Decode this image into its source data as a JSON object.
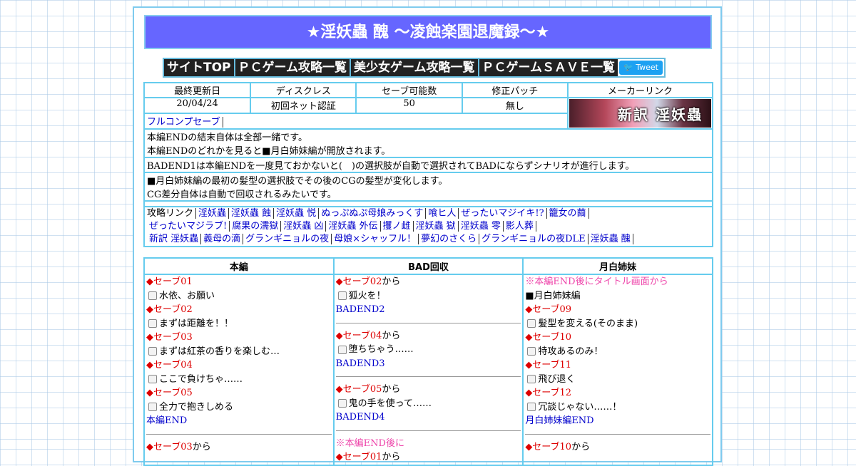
{
  "banner": {
    "title": "★淫妖蟲 醜 ～凌蝕楽園退魔録～★"
  },
  "nav": {
    "items": [
      "サイトTOP",
      "ＰＣゲーム攻略一覧",
      "美少女ゲーム攻略一覧",
      "ＰＣゲームＳＡＶＥ一覧"
    ],
    "tweet": "Tweet"
  },
  "info": {
    "headers": [
      "最終更新日",
      "ディスクレス",
      "セーブ可能数",
      "修正パッチ",
      "メーカーリンク"
    ],
    "values": [
      "20/04/24",
      "初回ネット認証",
      "50",
      "無し"
    ],
    "save_link": "フルコンプセーブ",
    "maker_banner_text": "新訳 淫妖蟲",
    "notes": [
      [
        "本編ENDの結末自体は全部一緒です。",
        "本編ENDのどれかを見ると■月白姉妹編が開放されます。"
      ],
      [
        "BADEND1は本編ENDを一度見ておかないと(　)の選択肢が自動で選択されてBADにならずシナリオが進行します。"
      ],
      [
        "■月白姉妹編の最初の髪型の選択肢でその後のCGの髪型が変化します。",
        "CG差分自体は自動で回収されるみたいです。"
      ]
    ],
    "links_label": "攻略リンク",
    "links": [
      [
        "淫妖蟲",
        "淫妖蟲 蝕",
        "淫妖蟲 悦",
        "ぬっぷぬぷ母娘みっくす",
        "喰ヒ人",
        "ぜったいマジイキ!?",
        "籠女の繭"
      ],
      [
        "ぜったいマジラブ!",
        "腐果の濡獄",
        "淫妖蟲 凶",
        "淫妖蟲 外伝",
        "攫ノ雌",
        "淫妖蟲 獄",
        "淫妖蟲 零",
        "影人葬"
      ],
      [
        "新訳 淫妖蟲",
        "義母の滴",
        "グランギニョルの夜",
        "母娘×シャッフル！",
        "夢幻のさくら",
        "グランギニョルの夜DLE",
        "淫妖蟲 醜"
      ]
    ]
  },
  "columns": {
    "headers": [
      "本編",
      "BAD回収",
      "月白姉妹"
    ],
    "col1": [
      {
        "t": "red",
        "text": "◆セーブ01"
      },
      {
        "t": "cb",
        "text": "水依、お願い"
      },
      {
        "t": "red",
        "text": "◆セーブ02"
      },
      {
        "t": "cb",
        "text": "まずは距離を！！"
      },
      {
        "t": "red",
        "text": "◆セーブ03"
      },
      {
        "t": "cb",
        "text": "まずは紅茶の香りを楽しむ…"
      },
      {
        "t": "red",
        "text": "◆セーブ04"
      },
      {
        "t": "cb",
        "text": "ここで負けちゃ……"
      },
      {
        "t": "red",
        "text": "◆セーブ05"
      },
      {
        "t": "cb",
        "text": "全力で抱きしめる"
      },
      {
        "t": "end",
        "text": "本編END"
      },
      {
        "t": "sep",
        "text": ""
      },
      {
        "t": "redfrom",
        "text": "◆セーブ03",
        "suffix": "から"
      }
    ],
    "col2": [
      {
        "t": "redfrom",
        "text": "◆セーブ02",
        "suffix": "から"
      },
      {
        "t": "cb",
        "text": "狐火を！"
      },
      {
        "t": "end",
        "text": "BADEND2"
      },
      {
        "t": "sep",
        "text": ""
      },
      {
        "t": "redfrom",
        "text": "◆セーブ04",
        "suffix": "から"
      },
      {
        "t": "cb",
        "text": "堕ちちゃう……"
      },
      {
        "t": "end",
        "text": "BADEND3"
      },
      {
        "t": "sep",
        "text": ""
      },
      {
        "t": "redfrom",
        "text": "◆セーブ05",
        "suffix": "から"
      },
      {
        "t": "cb",
        "text": "鬼の手を使って……"
      },
      {
        "t": "end",
        "text": "BADEND4"
      },
      {
        "t": "sep",
        "text": ""
      },
      {
        "t": "pink",
        "text": "※本編END後に"
      },
      {
        "t": "redfrom",
        "text": "◆セーブ01",
        "suffix": "から"
      }
    ],
    "col3": [
      {
        "t": "pink",
        "text": "※本編END後にタイトル画面から"
      },
      {
        "t": "plain",
        "text": "■月白姉妹編"
      },
      {
        "t": "red",
        "text": "◆セーブ09"
      },
      {
        "t": "cb",
        "text": "髪型を変える(そのまま)"
      },
      {
        "t": "red",
        "text": "◆セーブ10"
      },
      {
        "t": "cb",
        "text": "特攻あるのみ！"
      },
      {
        "t": "red",
        "text": "◆セーブ11"
      },
      {
        "t": "cb",
        "text": "飛び退く"
      },
      {
        "t": "red",
        "text": "◆セーブ12"
      },
      {
        "t": "cb",
        "text": "冗談じゃない……！"
      },
      {
        "t": "end",
        "text": "月白姉妹編END"
      },
      {
        "t": "sep",
        "text": ""
      },
      {
        "t": "redfrom",
        "text": "◆セーブ10",
        "suffix": "から"
      }
    ]
  }
}
